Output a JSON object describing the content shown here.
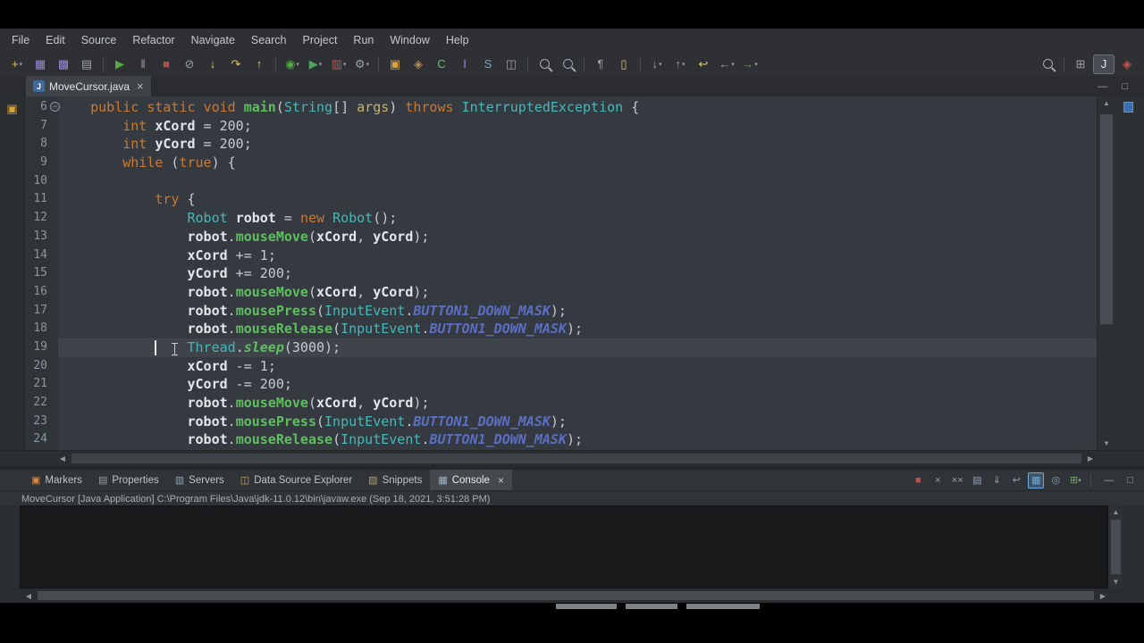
{
  "menu": {
    "items": [
      "File",
      "Edit",
      "Source",
      "Refactor",
      "Navigate",
      "Search",
      "Project",
      "Run",
      "Window",
      "Help"
    ]
  },
  "toolbar": {
    "left": [
      {
        "name": "new-wizard",
        "glyph": "+",
        "color": "#D9C26A",
        "dd": true
      },
      {
        "name": "save",
        "glyph": "▦",
        "color": "#9A86D9"
      },
      {
        "name": "save-all",
        "glyph": "▩",
        "color": "#9A86D9"
      },
      {
        "name": "print",
        "glyph": "▤",
        "color": "#9AA0A6"
      },
      {
        "sep": true
      },
      {
        "name": "run-resume",
        "glyph": "▶",
        "color": "#57A64A"
      },
      {
        "name": "pause",
        "glyph": "‖",
        "color": "#9AA0A6"
      },
      {
        "name": "terminate",
        "glyph": "■",
        "color": "#A65050"
      },
      {
        "name": "disconnect",
        "glyph": "⊘",
        "color": "#9AA0A6"
      },
      {
        "name": "step-into",
        "glyph": "↓",
        "color": "#D9C26A"
      },
      {
        "name": "step-over",
        "glyph": "↷",
        "color": "#D9C26A"
      },
      {
        "name": "step-return",
        "glyph": "↑",
        "color": "#D9C26A"
      },
      {
        "sep": true
      },
      {
        "name": "debug",
        "glyph": "◉",
        "color": "#57A64A",
        "dd": true
      },
      {
        "name": "run",
        "glyph": "▶",
        "color": "#4FA45B",
        "dd": true
      },
      {
        "name": "coverage",
        "glyph": "▥",
        "color": "#C75450",
        "dd": true
      },
      {
        "name": "external-tools",
        "glyph": "⚙",
        "color": "#9AA0A6",
        "dd": true
      },
      {
        "sep": true
      },
      {
        "name": "new-java-project",
        "glyph": "▣",
        "color": "#D9A33B"
      },
      {
        "name": "new-java-package",
        "glyph": "◈",
        "color": "#B58A5A"
      },
      {
        "name": "new-java-class",
        "glyph": "C",
        "color": "#6FBF6F"
      },
      {
        "name": "new-interface",
        "glyph": "I",
        "color": "#9A86D9"
      },
      {
        "name": "new-servlet",
        "glyph": "S",
        "color": "#6FA8DC"
      },
      {
        "name": "open-task",
        "glyph": "◫",
        "color": "#9AA0A6"
      },
      {
        "sep": true
      },
      {
        "name": "search",
        "mag": true,
        "color": "#A7ACB1"
      },
      {
        "name": "open-type",
        "mag": true,
        "color": "#8FA5B8"
      },
      {
        "sep": true
      },
      {
        "name": "show-whitespace",
        "glyph": "¶",
        "color": "#9AA0A6"
      },
      {
        "name": "mark-occurrences",
        "glyph": "▯",
        "color": "#D9C26A"
      },
      {
        "sep": true
      },
      {
        "name": "next-annotation",
        "glyph": "↓",
        "color": "#9AA0A6",
        "dd": true
      },
      {
        "name": "previous-annotation",
        "glyph": "↑",
        "color": "#9AA0A6",
        "dd": true
      },
      {
        "name": "last-edit-location",
        "glyph": "↩",
        "color": "#D9C26A"
      },
      {
        "name": "back",
        "glyph": "←",
        "color": "#9AA0A6",
        "dd": true
      },
      {
        "name": "forward",
        "glyph": "→",
        "color": "#57A64A",
        "dd": true
      }
    ],
    "right": [
      {
        "name": "quick-search",
        "mag": true,
        "color": "#A7ACB1"
      },
      {
        "sep": true
      },
      {
        "name": "open-perspective",
        "glyph": "⊞",
        "color": "#9AA0A6"
      },
      {
        "name": "java-ee-perspective",
        "glyph": "J",
        "color": "#E8EBED",
        "active": true
      },
      {
        "name": "java-perspective",
        "glyph": "◈",
        "color": "#C75450"
      }
    ]
  },
  "editor_tab": {
    "label": "MoveCursor.java",
    "close": "×",
    "file_icon_letter": "J"
  },
  "window_buttons": {
    "minimize": "—",
    "maximize": "□"
  },
  "editor": {
    "fold_glyph": "−",
    "lines": [
      {
        "num": "6",
        "fold": true,
        "tokens": [
          [
            "p",
            "    "
          ],
          [
            "k",
            "public"
          ],
          [
            "p",
            " "
          ],
          [
            "k",
            "static"
          ],
          [
            "p",
            " "
          ],
          [
            "k",
            "void"
          ],
          [
            "p",
            " "
          ],
          [
            "m",
            "main"
          ],
          [
            "p",
            "("
          ],
          [
            "t",
            "String"
          ],
          [
            "p",
            "[] "
          ],
          [
            "a",
            "args"
          ],
          [
            "p",
            ") "
          ],
          [
            "k",
            "throws"
          ],
          [
            "p",
            " "
          ],
          [
            "t",
            "InterruptedException"
          ],
          [
            "p",
            " {"
          ]
        ]
      },
      {
        "num": "7",
        "tokens": [
          [
            "p",
            "        "
          ],
          [
            "k",
            "int"
          ],
          [
            "p",
            " "
          ],
          [
            "v",
            "xCord"
          ],
          [
            "p",
            " = "
          ],
          [
            "n",
            "200"
          ],
          [
            "p",
            ";"
          ]
        ]
      },
      {
        "num": "8",
        "tokens": [
          [
            "p",
            "        "
          ],
          [
            "k",
            "int"
          ],
          [
            "p",
            " "
          ],
          [
            "v",
            "yCord"
          ],
          [
            "p",
            " = "
          ],
          [
            "n",
            "200"
          ],
          [
            "p",
            ";"
          ]
        ]
      },
      {
        "num": "9",
        "tokens": [
          [
            "p",
            "        "
          ],
          [
            "k",
            "while"
          ],
          [
            "p",
            " ("
          ],
          [
            "k",
            "true"
          ],
          [
            "p",
            ") {"
          ]
        ]
      },
      {
        "num": "10",
        "tokens": []
      },
      {
        "num": "11",
        "tokens": [
          [
            "p",
            "            "
          ],
          [
            "k",
            "try"
          ],
          [
            "p",
            " {"
          ]
        ]
      },
      {
        "num": "12",
        "tokens": [
          [
            "p",
            "                "
          ],
          [
            "t",
            "Robot"
          ],
          [
            "p",
            " "
          ],
          [
            "v",
            "robot"
          ],
          [
            "p",
            " = "
          ],
          [
            "k",
            "new"
          ],
          [
            "p",
            " "
          ],
          [
            "t",
            "Robot"
          ],
          [
            "p",
            "();"
          ]
        ]
      },
      {
        "num": "13",
        "tokens": [
          [
            "p",
            "                "
          ],
          [
            "v",
            "robot"
          ],
          [
            "p",
            "."
          ],
          [
            "m",
            "mouseMove"
          ],
          [
            "p",
            "("
          ],
          [
            "v",
            "xCord"
          ],
          [
            "p",
            ", "
          ],
          [
            "v",
            "yCord"
          ],
          [
            "p",
            ");"
          ]
        ]
      },
      {
        "num": "14",
        "tokens": [
          [
            "p",
            "                "
          ],
          [
            "v",
            "xCord"
          ],
          [
            "p",
            " += "
          ],
          [
            "n",
            "1"
          ],
          [
            "p",
            ";"
          ]
        ]
      },
      {
        "num": "15",
        "tokens": [
          [
            "p",
            "                "
          ],
          [
            "v",
            "yCord"
          ],
          [
            "p",
            " += "
          ],
          [
            "n",
            "200"
          ],
          [
            "p",
            ";"
          ]
        ]
      },
      {
        "num": "16",
        "tokens": [
          [
            "p",
            "                "
          ],
          [
            "v",
            "robot"
          ],
          [
            "p",
            "."
          ],
          [
            "m",
            "mouseMove"
          ],
          [
            "p",
            "("
          ],
          [
            "v",
            "xCord"
          ],
          [
            "p",
            ", "
          ],
          [
            "v",
            "yCord"
          ],
          [
            "p",
            ");"
          ]
        ]
      },
      {
        "num": "17",
        "tokens": [
          [
            "p",
            "                "
          ],
          [
            "v",
            "robot"
          ],
          [
            "p",
            "."
          ],
          [
            "m",
            "mousePress"
          ],
          [
            "p",
            "("
          ],
          [
            "t",
            "InputEvent"
          ],
          [
            "p",
            "."
          ],
          [
            "c",
            "BUTTON1_DOWN_MASK"
          ],
          [
            "p",
            ");"
          ]
        ]
      },
      {
        "num": "18",
        "tokens": [
          [
            "p",
            "                "
          ],
          [
            "v",
            "robot"
          ],
          [
            "p",
            "."
          ],
          [
            "m",
            "mouseRelease"
          ],
          [
            "p",
            "("
          ],
          [
            "t",
            "InputEvent"
          ],
          [
            "p",
            "."
          ],
          [
            "c",
            "BUTTON1_DOWN_MASK"
          ],
          [
            "p",
            ");"
          ]
        ]
      },
      {
        "num": "19",
        "active": true,
        "tokens": [
          [
            "p",
            "                "
          ],
          [
            "t",
            "Thread"
          ],
          [
            "p",
            "."
          ],
          [
            "sm",
            "sleep"
          ],
          [
            "p",
            "("
          ],
          [
            "n",
            "3000"
          ],
          [
            "p",
            ");"
          ]
        ]
      },
      {
        "num": "20",
        "tokens": [
          [
            "p",
            "                "
          ],
          [
            "v",
            "xCord"
          ],
          [
            "p",
            " -= "
          ],
          [
            "n",
            "1"
          ],
          [
            "p",
            ";"
          ]
        ]
      },
      {
        "num": "21",
        "tokens": [
          [
            "p",
            "                "
          ],
          [
            "v",
            "yCord"
          ],
          [
            "p",
            " -= "
          ],
          [
            "n",
            "200"
          ],
          [
            "p",
            ";"
          ]
        ]
      },
      {
        "num": "22",
        "tokens": [
          [
            "p",
            "                "
          ],
          [
            "v",
            "robot"
          ],
          [
            "p",
            "."
          ],
          [
            "m",
            "mouseMove"
          ],
          [
            "p",
            "("
          ],
          [
            "v",
            "xCord"
          ],
          [
            "p",
            ", "
          ],
          [
            "v",
            "yCord"
          ],
          [
            "p",
            ");"
          ]
        ]
      },
      {
        "num": "23",
        "tokens": [
          [
            "p",
            "                "
          ],
          [
            "v",
            "robot"
          ],
          [
            "p",
            "."
          ],
          [
            "m",
            "mousePress"
          ],
          [
            "p",
            "("
          ],
          [
            "t",
            "InputEvent"
          ],
          [
            "p",
            "."
          ],
          [
            "c",
            "BUTTON1_DOWN_MASK"
          ],
          [
            "p",
            ");"
          ]
        ]
      },
      {
        "num": "24",
        "tokens": [
          [
            "p",
            "                "
          ],
          [
            "v",
            "robot"
          ],
          [
            "p",
            "."
          ],
          [
            "m",
            "mouseRelease"
          ],
          [
            "p",
            "("
          ],
          [
            "t",
            "InputEvent"
          ],
          [
            "p",
            "."
          ],
          [
            "c",
            "BUTTON1_DOWN_MASK"
          ],
          [
            "p",
            ");"
          ]
        ]
      }
    ]
  },
  "scrollbars": {
    "up": "▲",
    "down": "▼",
    "left": "◀",
    "right": "▶"
  },
  "bottom_tabs": [
    {
      "name": "markers",
      "label": "Markers",
      "glyph": "▣",
      "color": "#D08B4C"
    },
    {
      "name": "properties",
      "label": "Properties",
      "glyph": "▤",
      "color": "#9AA0A6"
    },
    {
      "name": "servers",
      "label": "Servers",
      "glyph": "▥",
      "color": "#8FA5B8"
    },
    {
      "name": "data-source-explorer",
      "label": "Data Source Explorer",
      "glyph": "◫",
      "color": "#C9A86A"
    },
    {
      "name": "snippets",
      "label": "Snippets",
      "glyph": "▨",
      "color": "#B0A070"
    },
    {
      "name": "console",
      "label": "Console",
      "glyph": "▦",
      "color": "#9FB6C9",
      "active": true,
      "close": "×"
    }
  ],
  "console": {
    "title": "MoveCursor [Java Application] C:\\Program Files\\Java\\jdk-11.0.12\\bin\\javaw.exe (Sep 18, 2021, 3:51:28 PM)",
    "toolbar": [
      {
        "name": "terminate",
        "glyph": "■",
        "color": "#D04A45"
      },
      {
        "name": "remove-launch",
        "glyph": "×",
        "color": "#9AA0A6"
      },
      {
        "name": "remove-all-terminated",
        "glyph": "××",
        "color": "#9AA0A6"
      },
      {
        "name": "clear-console",
        "glyph": "▤",
        "color": "#8FA5B8"
      },
      {
        "name": "scroll-lock",
        "glyph": "⇓",
        "color": "#9AA0A6"
      },
      {
        "name": "word-wrap",
        "glyph": "↩",
        "color": "#8FA5B8"
      },
      {
        "name": "display-selected-console",
        "glyph": "▦",
        "color": "#6FA8DC",
        "active": true
      },
      {
        "name": "pin-console",
        "glyph": "◎",
        "color": "#8FA5B8"
      },
      {
        "name": "open-console",
        "glyph": "⊞",
        "color": "#79A86F",
        "dd": true
      }
    ]
  },
  "colors": {
    "editor_bg": "#343A40",
    "gutter_bg": "#2F3439",
    "chrome_bg": "#2E3033",
    "console_bg": "#17191B",
    "keyword": "#CC7832",
    "type": "#45B8B8",
    "method": "#5FBE5F",
    "constant": "#5C6EC2",
    "accent_marker": "#3B6EAE"
  }
}
